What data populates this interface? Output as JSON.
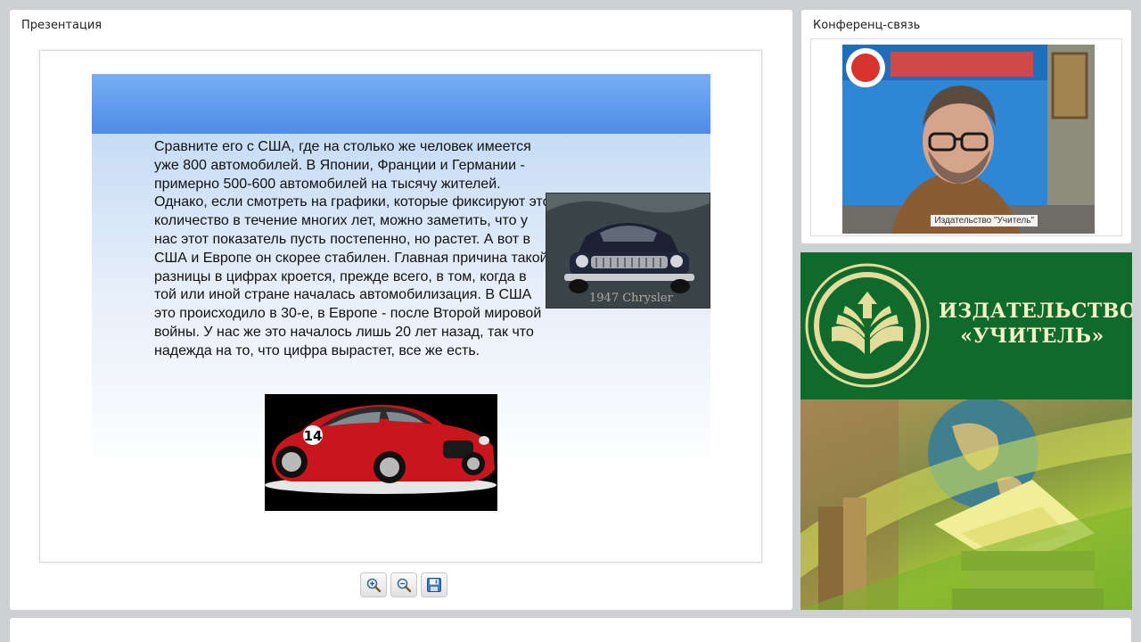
{
  "presentation": {
    "title": "Презентация",
    "slide_text": "Сравните его с США, где на столько же человек имеется уже 800 автомобилей. В Японии, Франции и Германии - примерно 500-600 автомобилей на тысячу жителей. Однако, если смотреть на графики, которые фиксируют это количество в течение многих лет, можно заметить, что у нас этот показатель пусть постепенно, но растет. А вот в США и Европе он скорее стабилен. Главная причина такой разницы в цифрах кроется, прежде всего, в том, когда в той или иной стране началась автомобилизация. В США это происходило в 30-е, в Европе - после Второй мировой войны. У нас же это началось лишь 20 лет назад, так что надежда на то, что цифра вырастет, все же есть.",
    "chrysler_caption": "1947 Chrysler",
    "ferrari_number": "14",
    "toolbar": {
      "zoom_in_icon": "zoom-in-icon",
      "zoom_out_icon": "zoom-out-icon",
      "save_icon": "save-icon"
    }
  },
  "conference": {
    "title": "Конференц-связь",
    "speaker_label": "Издательство \"Учитель\""
  },
  "publisher_banner": {
    "line1": "ИЗДАТЕЛЬСТВО",
    "line2": "«УЧИТЕЛЬ»"
  },
  "colors": {
    "publisher_green": "#0f6b2c",
    "slide_band": "#4f8be8",
    "logo_gold": "#e4dc9a"
  }
}
